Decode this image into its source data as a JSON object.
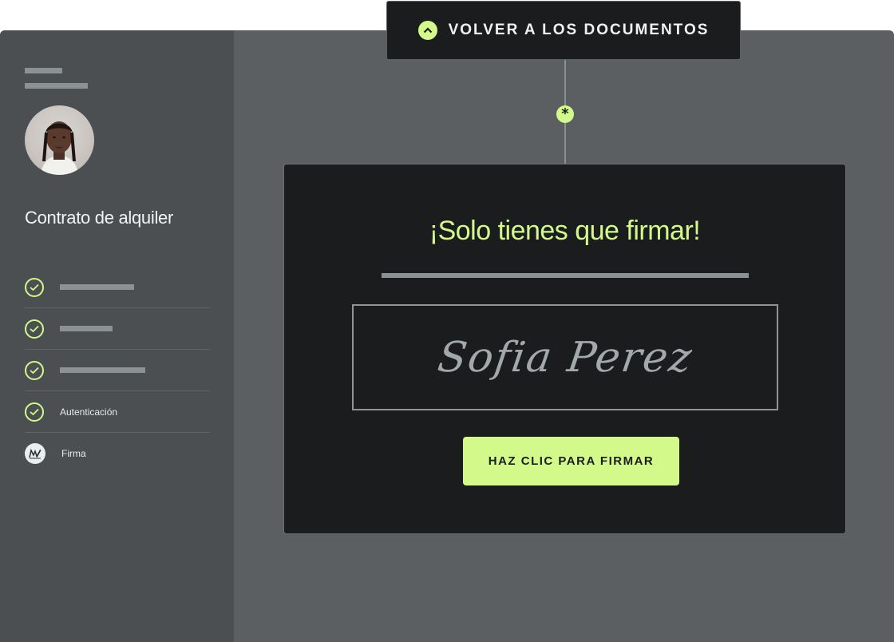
{
  "header": {
    "back_label": "VOLVER A LOS DOCUMENTOS"
  },
  "sidebar": {
    "document_title": "Contrato de alquiler",
    "steps": [
      {
        "status": "complete",
        "label": ""
      },
      {
        "status": "complete",
        "label": ""
      },
      {
        "status": "complete",
        "label": ""
      },
      {
        "status": "complete",
        "label": "Autenticación"
      },
      {
        "status": "current",
        "label": "Firma"
      }
    ]
  },
  "panel": {
    "heading": "¡Solo tienes que firmar!",
    "signature_name": "Sofia Perez",
    "sign_button_label": "HAZ CLIC PARA FIRMAR"
  },
  "connector": {
    "marker": "*"
  },
  "icons": {
    "back": "chevron-up-icon",
    "step_complete": "check-circle-icon",
    "step_current": "signature-icon"
  },
  "colors": {
    "accent": "#d2f98a",
    "panel_bg": "#1b1c1e",
    "sidebar_bg": "#4b4f51",
    "canvas_bg": "#5b5f61"
  }
}
